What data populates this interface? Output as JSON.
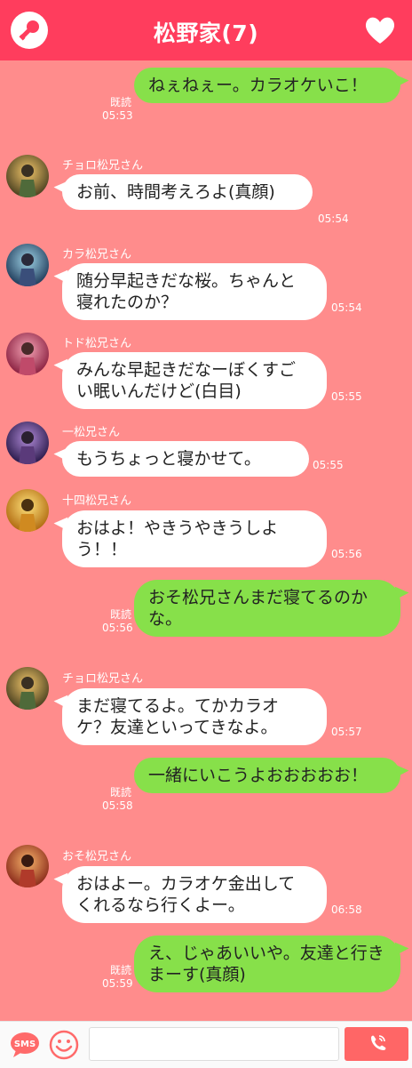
{
  "header": {
    "title": "松野家(7)"
  },
  "messages": [
    {
      "dir": "out",
      "text": "ねぇねぇー。カラオケいこ！",
      "time": "05:53",
      "read": "既読"
    },
    {
      "dir": "in",
      "sender": "チョロ松兄さん",
      "text": "お前、時間考えろよ(真顔)",
      "time": "05:54"
    },
    {
      "dir": "in",
      "sender": "カラ松兄さん",
      "text": "随分早起きだな桜。ちゃんと寝れたのか？",
      "time": "05:54"
    },
    {
      "dir": "in",
      "sender": "トド松兄さん",
      "text": "みんな早起きだなーぼくすごい眠いんだけど(白目)",
      "time": "05:55"
    },
    {
      "dir": "in",
      "sender": "一松兄さん",
      "text": "もうちょっと寝かせて。",
      "time": "05:55"
    },
    {
      "dir": "in",
      "sender": "十四松兄さん",
      "text": "おはよ！やきうやきうしよう！！",
      "time": "05:56"
    },
    {
      "dir": "out",
      "text": "おそ松兄さんまだ寝てるのかな。",
      "time": "05:56",
      "read": "既読"
    },
    {
      "dir": "in",
      "sender": "チョロ松兄さん",
      "text": "まだ寝てるよ。てかカラオケ？友達といってきなよ。",
      "time": "05:57"
    },
    {
      "dir": "out",
      "text": "一緒にいこうよおおおおお！",
      "time": "05:58",
      "read": "既読"
    },
    {
      "dir": "in",
      "sender": "おそ松兄さん",
      "text": "おはよー。カラオケ金出してくれるなら行くよー。",
      "time": "06:58"
    },
    {
      "dir": "out",
      "text": "え、じゃあいいや。友達と行きまーす(真顔)",
      "time": "05:59",
      "read": "既読"
    }
  ],
  "footer": {
    "sms_label": "SMS",
    "input_value": ""
  },
  "icons": {
    "header_left": "key-icon",
    "header_right": "heart-icon",
    "footer_sms": "sms-icon",
    "footer_emoji": "smiley-icon",
    "footer_send": "phone-icon"
  },
  "colors": {
    "header": "#ff3d5d",
    "background": "#ff8c8c",
    "outgoing_bubble": "#87e04a",
    "incoming_bubble": "#ffffff",
    "send_button": "#ff6666"
  }
}
